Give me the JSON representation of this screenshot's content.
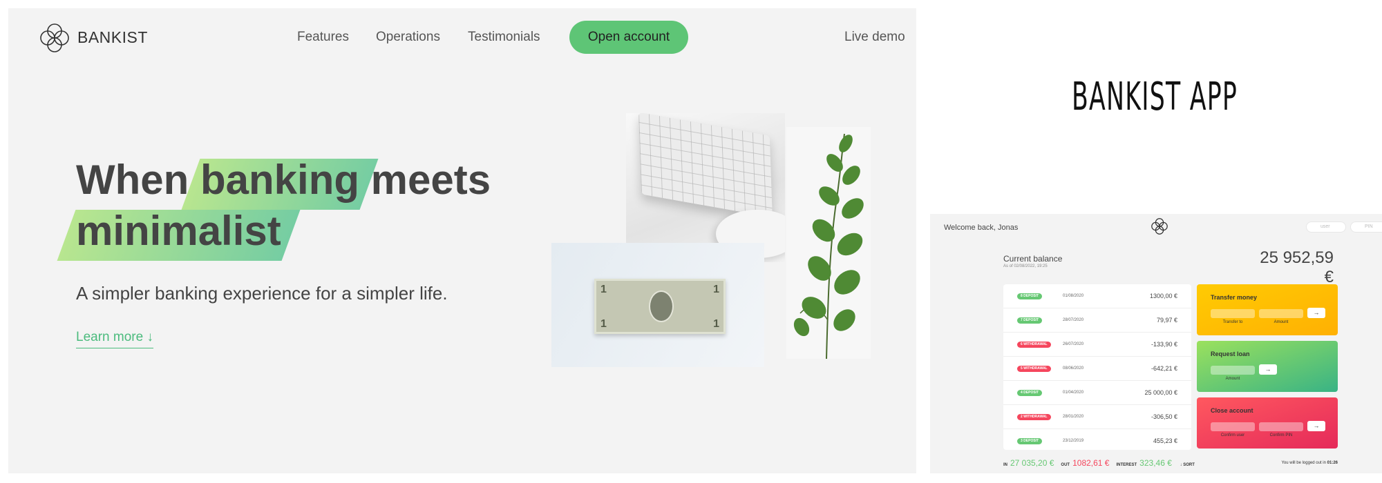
{
  "landing": {
    "nav": {
      "brand": "BANKIST",
      "links": [
        "Features",
        "Operations",
        "Testimonials"
      ],
      "cta": "Open account",
      "live_demo": "Live demo"
    },
    "hero": {
      "title_word1": "When",
      "title_highlight1": "banking",
      "title_word2": "meets",
      "title_highlight2": "minimalist",
      "subtitle": "A simpler banking experience for a simpler life.",
      "learn_more": "Learn more ↓"
    },
    "bill": {
      "denom": "1"
    }
  },
  "app_heading": "BANKIST APP",
  "app": {
    "welcome": "Welcome back, Jonas",
    "login_user_placeholder": "user",
    "login_pin_placeholder": "PIN",
    "balance_label": "Current balance",
    "balance_date": "As of 02/08/2022, 19:25",
    "balance_value": "25 952,59 €",
    "movements": [
      {
        "type": "8 DEPOSIT",
        "kind": "deposit",
        "date": "01/08/2020",
        "value": "1300,00 €"
      },
      {
        "type": "7 DEPOSIT",
        "kind": "deposit",
        "date": "28/07/2020",
        "value": "79,97 €"
      },
      {
        "type": "6 WITHDRAWAL",
        "kind": "withdrawal",
        "date": "26/07/2020",
        "value": "-133,90 €"
      },
      {
        "type": "5 WITHDRAWAL",
        "kind": "withdrawal",
        "date": "08/06/2020",
        "value": "-642,21 €"
      },
      {
        "type": "4 DEPOSIT",
        "kind": "deposit",
        "date": "01/04/2020",
        "value": "25 000,00 €"
      },
      {
        "type": "2 WITHDRAWAL",
        "kind": "withdrawal",
        "date": "28/01/2020",
        "value": "-306,50 €"
      },
      {
        "type": "3 DEPOSIT",
        "kind": "deposit",
        "date": "23/12/2019",
        "value": "455,23 €"
      }
    ],
    "transfer": {
      "title": "Transfer money",
      "label1": "Transfer to",
      "label2": "Amount",
      "button": "→"
    },
    "loan": {
      "title": "Request loan",
      "label1": "Amount",
      "button": "→"
    },
    "close": {
      "title": "Close account",
      "label1": "Confirm user",
      "label2": "Confirm PIN",
      "button": "→"
    },
    "summary": {
      "in_label": "IN",
      "in_value": "27 035,20 €",
      "out_label": "OUT",
      "out_value": "1082,61 €",
      "interest_label": "INTEREST",
      "interest_value": "323,46 €",
      "sort": "↓ SORT"
    },
    "logout_text": "You will be logged out in",
    "logout_timer": "01:26"
  },
  "colors": {
    "primary": "#5ec576",
    "deposit": "#66c873",
    "withdrawal": "#f5465d",
    "transfer_bg": "#ffcb03",
    "loan_bg": "#5ec576",
    "close_bg": "#f5465d"
  }
}
